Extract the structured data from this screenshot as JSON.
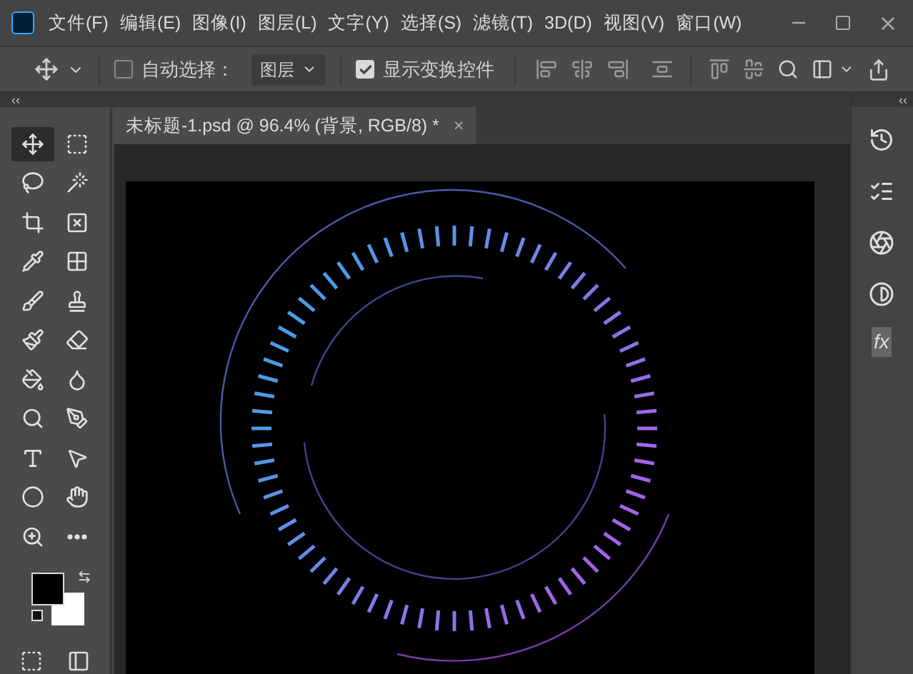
{
  "menu": [
    "文件(F)",
    "编辑(E)",
    "图像(I)",
    "图层(L)",
    "文字(Y)",
    "选择(S)",
    "滤镜(T)",
    "3D(D)",
    "视图(V)",
    "窗口(W)"
  ],
  "options_bar": {
    "auto_select": {
      "label": "自动选择：",
      "checked": false
    },
    "target": {
      "value": "图层"
    },
    "show_transform": {
      "label": "显示变换控件",
      "checked": true
    }
  },
  "panel_collapse_left": "‹‹",
  "panel_collapse_right": "‹‹",
  "document_tab": {
    "title": "未标题-1.psd @ 96.4% (背景, RGB/8) *",
    "close": "×"
  },
  "tools": [
    {
      "selected": true
    },
    {
      "selected": false
    },
    {
      "selected": false
    },
    {
      "selected": false
    },
    {
      "selected": false
    },
    {
      "selected": false
    },
    {
      "selected": false
    },
    {
      "selected": false
    },
    {
      "selected": false
    },
    {
      "selected": false
    },
    {
      "selected": false
    },
    {
      "selected": false
    },
    {
      "selected": false
    },
    {
      "selected": false
    },
    {
      "selected": false
    },
    {
      "selected": false
    },
    {
      "selected": false
    },
    {
      "selected": false
    },
    {
      "selected": false
    },
    {
      "selected": false
    },
    {
      "selected": false
    },
    {
      "selected": false
    }
  ],
  "adjustment_panel": {
    "fx_label": "fx"
  }
}
